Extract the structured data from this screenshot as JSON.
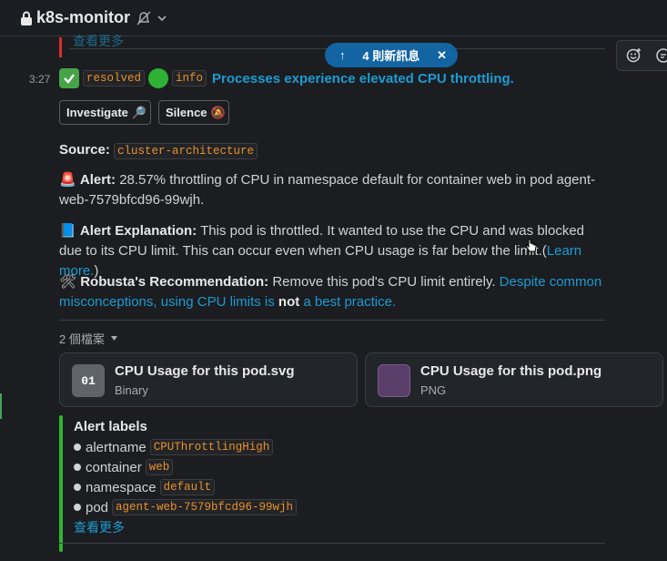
{
  "header": {
    "channel_name": "k8s-monitor"
  },
  "prev_message": {
    "link_text": "查看更多"
  },
  "new_messages": {
    "label": "4 則新訊息"
  },
  "message": {
    "time": "3:27",
    "status_tag": "resolved",
    "severity_tag": "info",
    "title": "Processes experience elevated CPU throttling.",
    "buttons": {
      "investigate": "Investigate",
      "silence": "Silence"
    },
    "source_label": "Source:",
    "source_value": "cluster-architecture",
    "alert_label": "Alert:",
    "alert_text": "28.57% throttling of CPU in namespace default for container web in pod agent-web-7579bfcd96-99wjh.",
    "explanation_label": "Alert Explanation:",
    "explanation_text": "This pod is throttled. It wanted to use the CPU and was blocked due to its CPU limit. This can occur even when CPU usage is far below the limit.(",
    "explanation_link": "Learn more.",
    "explanation_close": ")",
    "recommendation_label": "Robusta's Recommendation:",
    "recommendation_text": "Remove this pod's CPU limit entirely.",
    "recommendation_link_a": "Despite common misconceptions, using CPU limits is",
    "recommendation_link_bold": "not",
    "recommendation_link_b": "a best practice."
  },
  "files": {
    "count_label": "2 個檔案",
    "items": [
      {
        "icon_text": "01",
        "name": "CPU Usage for this pod.svg",
        "type": "Binary"
      },
      {
        "name": "CPU Usage for this pod.png",
        "type": "PNG"
      }
    ]
  },
  "attachment": {
    "title": "Alert labels",
    "labels": [
      {
        "key": "alertname",
        "value": "CPUThrottlingHigh"
      },
      {
        "key": "container",
        "value": "web"
      },
      {
        "key": "namespace",
        "value": "default"
      },
      {
        "key": "pod",
        "value": "agent-web-7579bfcd96-99wjh"
      }
    ],
    "show_more": "查看更多"
  },
  "colors": {
    "accent_blue": "#1264a3",
    "link": "#1d9bd1",
    "attachment_bar": "#2eb631",
    "alert_red": "#d93025"
  }
}
